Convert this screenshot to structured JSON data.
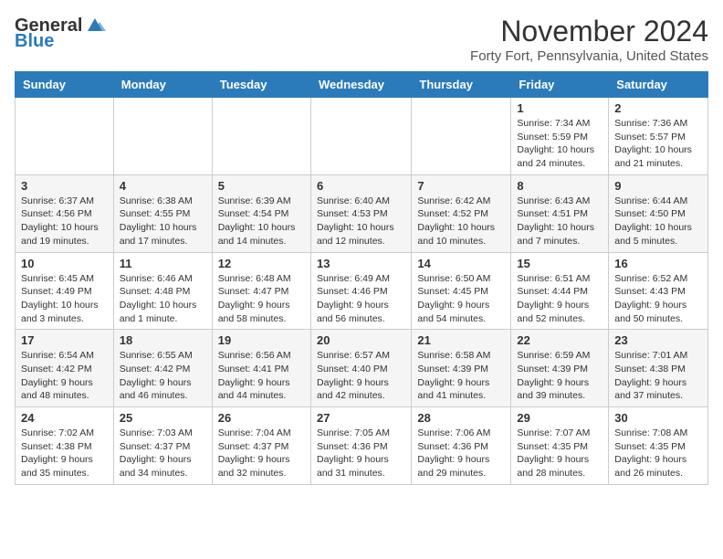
{
  "logo": {
    "general": "General",
    "blue": "Blue"
  },
  "title": "November 2024",
  "location": "Forty Fort, Pennsylvania, United States",
  "days_header": [
    "Sunday",
    "Monday",
    "Tuesday",
    "Wednesday",
    "Thursday",
    "Friday",
    "Saturday"
  ],
  "weeks": [
    [
      {
        "day": "",
        "info": ""
      },
      {
        "day": "",
        "info": ""
      },
      {
        "day": "",
        "info": ""
      },
      {
        "day": "",
        "info": ""
      },
      {
        "day": "",
        "info": ""
      },
      {
        "day": "1",
        "info": "Sunrise: 7:34 AM\nSunset: 5:59 PM\nDaylight: 10 hours and 24 minutes."
      },
      {
        "day": "2",
        "info": "Sunrise: 7:36 AM\nSunset: 5:57 PM\nDaylight: 10 hours and 21 minutes."
      }
    ],
    [
      {
        "day": "3",
        "info": "Sunrise: 6:37 AM\nSunset: 4:56 PM\nDaylight: 10 hours and 19 minutes."
      },
      {
        "day": "4",
        "info": "Sunrise: 6:38 AM\nSunset: 4:55 PM\nDaylight: 10 hours and 17 minutes."
      },
      {
        "day": "5",
        "info": "Sunrise: 6:39 AM\nSunset: 4:54 PM\nDaylight: 10 hours and 14 minutes."
      },
      {
        "day": "6",
        "info": "Sunrise: 6:40 AM\nSunset: 4:53 PM\nDaylight: 10 hours and 12 minutes."
      },
      {
        "day": "7",
        "info": "Sunrise: 6:42 AM\nSunset: 4:52 PM\nDaylight: 10 hours and 10 minutes."
      },
      {
        "day": "8",
        "info": "Sunrise: 6:43 AM\nSunset: 4:51 PM\nDaylight: 10 hours and 7 minutes."
      },
      {
        "day": "9",
        "info": "Sunrise: 6:44 AM\nSunset: 4:50 PM\nDaylight: 10 hours and 5 minutes."
      }
    ],
    [
      {
        "day": "10",
        "info": "Sunrise: 6:45 AM\nSunset: 4:49 PM\nDaylight: 10 hours and 3 minutes."
      },
      {
        "day": "11",
        "info": "Sunrise: 6:46 AM\nSunset: 4:48 PM\nDaylight: 10 hours and 1 minute."
      },
      {
        "day": "12",
        "info": "Sunrise: 6:48 AM\nSunset: 4:47 PM\nDaylight: 9 hours and 58 minutes."
      },
      {
        "day": "13",
        "info": "Sunrise: 6:49 AM\nSunset: 4:46 PM\nDaylight: 9 hours and 56 minutes."
      },
      {
        "day": "14",
        "info": "Sunrise: 6:50 AM\nSunset: 4:45 PM\nDaylight: 9 hours and 54 minutes."
      },
      {
        "day": "15",
        "info": "Sunrise: 6:51 AM\nSunset: 4:44 PM\nDaylight: 9 hours and 52 minutes."
      },
      {
        "day": "16",
        "info": "Sunrise: 6:52 AM\nSunset: 4:43 PM\nDaylight: 9 hours and 50 minutes."
      }
    ],
    [
      {
        "day": "17",
        "info": "Sunrise: 6:54 AM\nSunset: 4:42 PM\nDaylight: 9 hours and 48 minutes."
      },
      {
        "day": "18",
        "info": "Sunrise: 6:55 AM\nSunset: 4:42 PM\nDaylight: 9 hours and 46 minutes."
      },
      {
        "day": "19",
        "info": "Sunrise: 6:56 AM\nSunset: 4:41 PM\nDaylight: 9 hours and 44 minutes."
      },
      {
        "day": "20",
        "info": "Sunrise: 6:57 AM\nSunset: 4:40 PM\nDaylight: 9 hours and 42 minutes."
      },
      {
        "day": "21",
        "info": "Sunrise: 6:58 AM\nSunset: 4:39 PM\nDaylight: 9 hours and 41 minutes."
      },
      {
        "day": "22",
        "info": "Sunrise: 6:59 AM\nSunset: 4:39 PM\nDaylight: 9 hours and 39 minutes."
      },
      {
        "day": "23",
        "info": "Sunrise: 7:01 AM\nSunset: 4:38 PM\nDaylight: 9 hours and 37 minutes."
      }
    ],
    [
      {
        "day": "24",
        "info": "Sunrise: 7:02 AM\nSunset: 4:38 PM\nDaylight: 9 hours and 35 minutes."
      },
      {
        "day": "25",
        "info": "Sunrise: 7:03 AM\nSunset: 4:37 PM\nDaylight: 9 hours and 34 minutes."
      },
      {
        "day": "26",
        "info": "Sunrise: 7:04 AM\nSunset: 4:37 PM\nDaylight: 9 hours and 32 minutes."
      },
      {
        "day": "27",
        "info": "Sunrise: 7:05 AM\nSunset: 4:36 PM\nDaylight: 9 hours and 31 minutes."
      },
      {
        "day": "28",
        "info": "Sunrise: 7:06 AM\nSunset: 4:36 PM\nDaylight: 9 hours and 29 minutes."
      },
      {
        "day": "29",
        "info": "Sunrise: 7:07 AM\nSunset: 4:35 PM\nDaylight: 9 hours and 28 minutes."
      },
      {
        "day": "30",
        "info": "Sunrise: 7:08 AM\nSunset: 4:35 PM\nDaylight: 9 hours and 26 minutes."
      }
    ]
  ]
}
